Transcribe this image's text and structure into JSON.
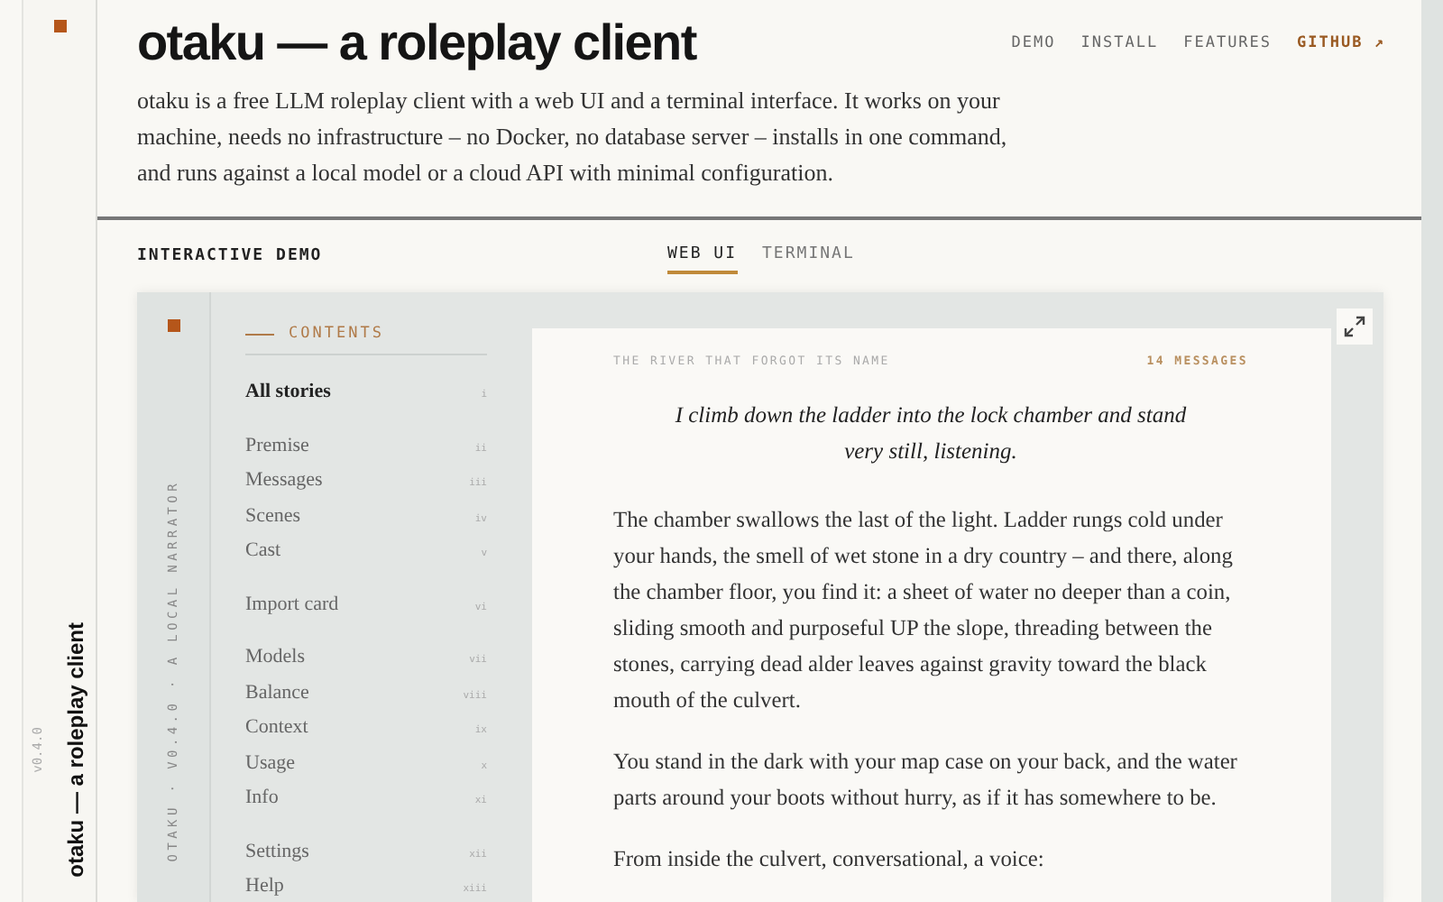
{
  "side_strip": {
    "title": "otaku — a roleplay client",
    "version": "v0.4.0"
  },
  "header": {
    "title": "otaku — a roleplay client",
    "nav": [
      {
        "label": "DEMO",
        "kind": "plain"
      },
      {
        "label": "INSTALL",
        "kind": "plain"
      },
      {
        "label": "FEATURES",
        "kind": "plain"
      },
      {
        "label": "GITHUB ↗",
        "kind": "accent"
      }
    ],
    "intro": "otaku is a free LLM roleplay client with a web UI and a terminal interface. It works on your machine, needs no infrastructure – no Docker, no database server – installs in one command, and runs against a local model or a cloud API with minimal configuration."
  },
  "demo": {
    "label": "INTERACTIVE DEMO",
    "tabs": [
      {
        "label": "WEB UI",
        "selected": true
      },
      {
        "label": "TERMINAL",
        "selected": false
      }
    ],
    "rail_text": "OTAKU · V0.4.0 · A LOCAL NARRATOR",
    "contents_title": "CONTENTS",
    "groups": [
      [
        {
          "label": "All stories",
          "numeral": "i",
          "selected": true
        }
      ],
      [
        {
          "label": "Premise",
          "numeral": "ii",
          "selected": false
        },
        {
          "label": "Messages",
          "numeral": "iii",
          "selected": false
        },
        {
          "label": "Scenes",
          "numeral": "iv",
          "selected": false
        },
        {
          "label": "Cast",
          "numeral": "v",
          "selected": false
        }
      ],
      [
        {
          "label": "Import card",
          "numeral": "vi",
          "selected": false
        }
      ],
      [
        {
          "label": "Models",
          "numeral": "vii",
          "selected": false
        },
        {
          "label": "Balance",
          "numeral": "viii",
          "selected": false
        },
        {
          "label": "Context",
          "numeral": "ix",
          "selected": false
        },
        {
          "label": "Usage",
          "numeral": "x",
          "selected": false
        },
        {
          "label": "Info",
          "numeral": "xi",
          "selected": false
        }
      ],
      [
        {
          "label": "Settings",
          "numeral": "xii",
          "selected": false
        },
        {
          "label": "Help",
          "numeral": "xiii",
          "selected": false
        }
      ]
    ],
    "story": {
      "title": "THE RIVER THAT FORGOT ITS NAME",
      "count": "14 MESSAGES",
      "user_turn": "I climb down the ladder into the lock chamber and stand very still, listening.",
      "paragraphs": [
        "The chamber swallows the last of the light. Ladder rungs cold under your hands, the smell of wet stone in a dry country – and there, along the chamber floor, you find it: a sheet of water no deeper than a coin, sliding smooth and purposeful UP the slope, threading between the stones, carrying dead alder leaves against gravity toward the black mouth of the culvert.",
        "You stand in the dark with your map case on your back, and the water parts around your boots without hurry, as if it has somewhere to be.",
        "From inside the culvert, conversational, a voice:"
      ]
    }
  }
}
